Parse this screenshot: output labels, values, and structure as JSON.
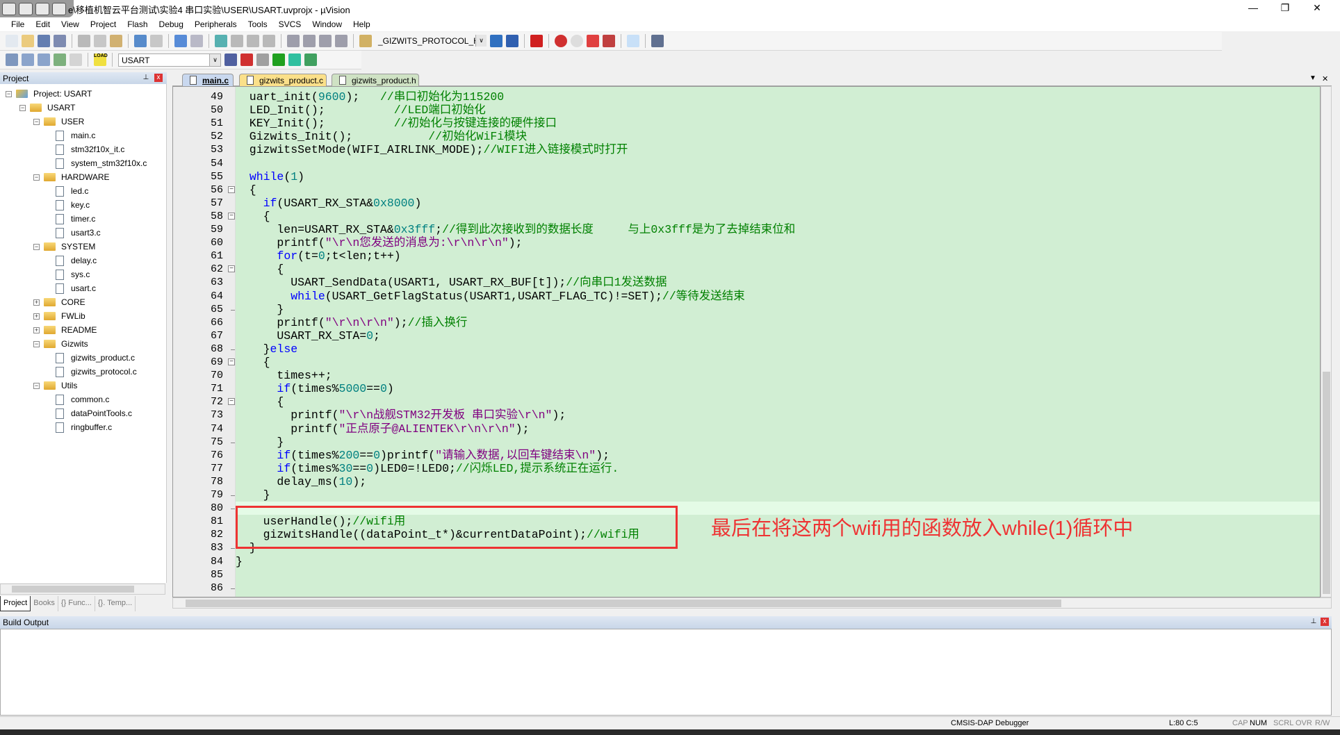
{
  "window": {
    "title": "e\\移植机智云平台测试\\实验4 串口实验\\USER\\USART.uvprojx - µVision",
    "minimize": "—",
    "maximize": "❐",
    "close": "✕"
  },
  "menu": [
    "File",
    "Edit",
    "View",
    "Project",
    "Flash",
    "Debug",
    "Peripherals",
    "Tools",
    "SVCS",
    "Window",
    "Help"
  ],
  "toolbar1": {
    "find_combo": "_GIZWITS_PROTOCOL_H",
    "icons": [
      "new-file-icon",
      "open-icon",
      "save-icon",
      "save-all-icon",
      "cut-icon",
      "copy-icon",
      "paste-icon",
      "undo-icon",
      "redo-icon",
      "back-icon",
      "forward-icon",
      "bookmark-icon",
      "prev-bookmark-icon",
      "next-bookmark-icon",
      "clear-bookmarks-icon",
      "indent-icon",
      "unindent-icon",
      "comment-icon",
      "uncomment-icon",
      "find-in-files-icon"
    ],
    "icons2": [
      "incremental-find-icon",
      "browse-icon",
      "debug-session-icon",
      "breakpoint-icon",
      "disable-breakpoint-icon",
      "disable-all-breakpoints-icon",
      "kill-breakpoints-icon",
      "window-layout-icon",
      "configure-icon"
    ]
  },
  "toolbar2": {
    "target_combo": "USART",
    "load_label": "LOAD",
    "icons": [
      "translate-icon",
      "build-icon",
      "rebuild-icon",
      "batch-build-icon",
      "stop-build-icon"
    ],
    "icons2": [
      "target-options-icon",
      "manage-components-icon",
      "file-extensions-icon",
      "select-packs-icon",
      "pack-installer-icon",
      "rte-icon"
    ]
  },
  "project_panel": {
    "title": "Project",
    "pin": "📌",
    "close": "x",
    "tree": [
      {
        "label": "Project: USART",
        "level": 0,
        "type": "root",
        "exp": "-"
      },
      {
        "label": "USART",
        "level": 1,
        "type": "target",
        "exp": "-"
      },
      {
        "label": "USER",
        "level": 2,
        "type": "folder",
        "exp": "-"
      },
      {
        "label": "main.c",
        "level": 3,
        "type": "file"
      },
      {
        "label": "stm32f10x_it.c",
        "level": 3,
        "type": "file"
      },
      {
        "label": "system_stm32f10x.c",
        "level": 3,
        "type": "file"
      },
      {
        "label": "HARDWARE",
        "level": 2,
        "type": "folder",
        "exp": "-"
      },
      {
        "label": "led.c",
        "level": 3,
        "type": "file"
      },
      {
        "label": "key.c",
        "level": 3,
        "type": "file"
      },
      {
        "label": "timer.c",
        "level": 3,
        "type": "file"
      },
      {
        "label": "usart3.c",
        "level": 3,
        "type": "file"
      },
      {
        "label": "SYSTEM",
        "level": 2,
        "type": "folder",
        "exp": "-"
      },
      {
        "label": "delay.c",
        "level": 3,
        "type": "file"
      },
      {
        "label": "sys.c",
        "level": 3,
        "type": "file"
      },
      {
        "label": "usart.c",
        "level": 3,
        "type": "file"
      },
      {
        "label": "CORE",
        "level": 2,
        "type": "folder",
        "exp": "+"
      },
      {
        "label": "FWLib",
        "level": 2,
        "type": "folder",
        "exp": "+"
      },
      {
        "label": "README",
        "level": 2,
        "type": "folder",
        "exp": "+"
      },
      {
        "label": "Gizwits",
        "level": 2,
        "type": "folder",
        "exp": "-"
      },
      {
        "label": "gizwits_product.c",
        "level": 3,
        "type": "file"
      },
      {
        "label": "gizwits_protocol.c",
        "level": 3,
        "type": "file"
      },
      {
        "label": "Utils",
        "level": 2,
        "type": "folder",
        "exp": "-"
      },
      {
        "label": "common.c",
        "level": 3,
        "type": "file"
      },
      {
        "label": "dataPointTools.c",
        "level": 3,
        "type": "file"
      },
      {
        "label": "ringbuffer.c",
        "level": 3,
        "type": "file"
      }
    ],
    "tabs": [
      "Project",
      "Books",
      "{} Func...",
      "{}. Temp..."
    ]
  },
  "editor": {
    "tabs": [
      {
        "label": "main.c",
        "color": "#c9d8ef",
        "active": true
      },
      {
        "label": "gizwits_product.c",
        "color": "#fbe08a"
      },
      {
        "label": "gizwits_product.h",
        "color": "#cfe2c4"
      }
    ],
    "tab_menu": "▼",
    "tab_close": "✕",
    "current_line": 80
  },
  "code": {
    "lines": [
      {
        "n": "49",
        "t": [
          [
            "  uart_init(",
            "p"
          ],
          [
            "9600",
            "n"
          ],
          [
            ");   ",
            "p"
          ],
          [
            "//串口初始化为115200",
            "c"
          ]
        ]
      },
      {
        "n": "50",
        "t": [
          [
            "  LED_Init();          ",
            "p"
          ],
          [
            "//LED端口初始化",
            "c"
          ]
        ]
      },
      {
        "n": "51",
        "t": [
          [
            "  KEY_Init();          ",
            "p"
          ],
          [
            "//初始化与按键连接的硬件接口",
            "c"
          ]
        ]
      },
      {
        "n": "52",
        "t": [
          [
            "  Gizwits_Init();           ",
            "p"
          ],
          [
            "//初始化WiFi模块",
            "c"
          ]
        ]
      },
      {
        "n": "53",
        "t": [
          [
            "  gizwitsSetMode(WIFI_AIRLINK_MODE);",
            "p"
          ],
          [
            "//WIFI进入链接模式时打开",
            "c"
          ]
        ]
      },
      {
        "n": "54",
        "t": []
      },
      {
        "n": "55",
        "t": [
          [
            "  ",
            "p"
          ],
          [
            "while",
            "k"
          ],
          [
            "(",
            "p"
          ],
          [
            "1",
            "n"
          ],
          [
            ")",
            "p"
          ]
        ]
      },
      {
        "n": "56",
        "f": "open",
        "t": [
          [
            "  {",
            "p"
          ]
        ]
      },
      {
        "n": "57",
        "t": [
          [
            "    ",
            "p"
          ],
          [
            "if",
            "k"
          ],
          [
            "(USART_RX_STA&",
            "p"
          ],
          [
            "0x8000",
            "n"
          ],
          [
            ")",
            "p"
          ]
        ]
      },
      {
        "n": "58",
        "f": "open",
        "t": [
          [
            "    {",
            "p"
          ]
        ]
      },
      {
        "n": "59",
        "t": [
          [
            "      len=USART_RX_STA&",
            "p"
          ],
          [
            "0x3fff",
            "n"
          ],
          [
            ";",
            "p"
          ],
          [
            "//得到此次接收到的数据长度     与上0x3fff是为了去掉结束位和",
            "c"
          ]
        ]
      },
      {
        "n": "60",
        "t": [
          [
            "      printf(",
            "p"
          ],
          [
            "\"\\r\\n您发送的消息为:\\r\\n\\r\\n\"",
            "s"
          ],
          [
            ");",
            "p"
          ]
        ]
      },
      {
        "n": "61",
        "t": [
          [
            "      ",
            "p"
          ],
          [
            "for",
            "k"
          ],
          [
            "(t=",
            "p"
          ],
          [
            "0",
            "n"
          ],
          [
            ";t<len;t++)",
            "p"
          ]
        ]
      },
      {
        "n": "62",
        "f": "open",
        "t": [
          [
            "      {",
            "p"
          ]
        ]
      },
      {
        "n": "63",
        "t": [
          [
            "        USART_SendData(USART1, USART_RX_BUF[t]);",
            "p"
          ],
          [
            "//向串口1发送数据",
            "c"
          ]
        ]
      },
      {
        "n": "64",
        "t": [
          [
            "        ",
            "p"
          ],
          [
            "while",
            "k"
          ],
          [
            "(USART_GetFlagStatus(USART1,USART_FLAG_TC)!=SET);",
            "p"
          ],
          [
            "//等待发送结束",
            "c"
          ]
        ]
      },
      {
        "n": "65",
        "f": "end",
        "t": [
          [
            "      }",
            "p"
          ]
        ]
      },
      {
        "n": "66",
        "t": [
          [
            "      printf(",
            "p"
          ],
          [
            "\"\\r\\n\\r\\n\"",
            "s"
          ],
          [
            ");",
            "p"
          ],
          [
            "//插入换行",
            "c"
          ]
        ]
      },
      {
        "n": "67",
        "t": [
          [
            "      USART_RX_STA=",
            "p"
          ],
          [
            "0",
            "n"
          ],
          [
            ";",
            "p"
          ]
        ]
      },
      {
        "n": "68",
        "f": "end",
        "t": [
          [
            "    }",
            "p"
          ],
          [
            "else",
            "k"
          ]
        ]
      },
      {
        "n": "69",
        "f": "open",
        "t": [
          [
            "    {",
            "p"
          ]
        ]
      },
      {
        "n": "70",
        "t": [
          [
            "      times++;",
            "p"
          ]
        ]
      },
      {
        "n": "71",
        "t": [
          [
            "      ",
            "p"
          ],
          [
            "if",
            "k"
          ],
          [
            "(times%",
            "p"
          ],
          [
            "5000",
            "n"
          ],
          [
            "==",
            "p"
          ],
          [
            "0",
            "n"
          ],
          [
            ")",
            "p"
          ]
        ]
      },
      {
        "n": "72",
        "f": "open",
        "t": [
          [
            "      {",
            "p"
          ]
        ]
      },
      {
        "n": "73",
        "t": [
          [
            "        printf(",
            "p"
          ],
          [
            "\"\\r\\n战舰STM32开发板 串口实验\\r\\n\"",
            "s"
          ],
          [
            ");",
            "p"
          ]
        ]
      },
      {
        "n": "74",
        "t": [
          [
            "        printf(",
            "p"
          ],
          [
            "\"正点原子@ALIENTEK\\r\\n\\r\\n\"",
            "s"
          ],
          [
            ");",
            "p"
          ]
        ]
      },
      {
        "n": "75",
        "f": "end",
        "t": [
          [
            "      }",
            "p"
          ]
        ]
      },
      {
        "n": "76",
        "t": [
          [
            "      ",
            "p"
          ],
          [
            "if",
            "k"
          ],
          [
            "(times%",
            "p"
          ],
          [
            "200",
            "n"
          ],
          [
            "==",
            "p"
          ],
          [
            "0",
            "n"
          ],
          [
            ")printf(",
            "p"
          ],
          [
            "\"请输入数据,以回车键结束\\n\"",
            "s"
          ],
          [
            ");",
            "p"
          ]
        ]
      },
      {
        "n": "77",
        "t": [
          [
            "      ",
            "p"
          ],
          [
            "if",
            "k"
          ],
          [
            "(times%",
            "p"
          ],
          [
            "30",
            "n"
          ],
          [
            "==",
            "p"
          ],
          [
            "0",
            "n"
          ],
          [
            ")LED0=!LED0;",
            "p"
          ],
          [
            "//闪烁LED,提示系统正在运行.",
            "c"
          ]
        ]
      },
      {
        "n": "78",
        "t": [
          [
            "      delay_ms(",
            "p"
          ],
          [
            "10",
            "n"
          ],
          [
            ");",
            "p"
          ]
        ]
      },
      {
        "n": "79",
        "f": "end",
        "t": [
          [
            "    }",
            "p"
          ]
        ]
      },
      {
        "n": "80",
        "f": "end",
        "t": []
      },
      {
        "n": "81",
        "t": [
          [
            "    userHandle();",
            "p"
          ],
          [
            "//wifi用",
            "c"
          ]
        ]
      },
      {
        "n": "82",
        "t": [
          [
            "    gizwitsHandle((dataPoint_t*)&currentDataPoint);",
            "p"
          ],
          [
            "//wifi用",
            "c"
          ]
        ]
      },
      {
        "n": "83",
        "f": "end",
        "t": [
          [
            "  }",
            "p"
          ]
        ]
      },
      {
        "n": "84",
        "t": [
          [
            "}",
            "p"
          ]
        ]
      },
      {
        "n": "85",
        "t": []
      },
      {
        "n": "86",
        "f": "end",
        "t": []
      }
    ]
  },
  "annotation": "最后在将这两个wifi用的函数放入while(1)循环中",
  "build_output": {
    "title": "Build Output",
    "pin": "📌",
    "close": "x"
  },
  "status": {
    "debugger": "CMSIS-DAP Debugger",
    "position": "L:80 C:5",
    "cap": "CAP",
    "num": "NUM",
    "scrl": "SCRL",
    "ovr": "OVR",
    "rw": "R/W"
  },
  "colors": {
    "editor_bg": "#d1eed3",
    "annotation": "#ee3333",
    "keyword": "#0000ff",
    "comment": "#008000",
    "string": "#800080",
    "number": "#008080"
  }
}
